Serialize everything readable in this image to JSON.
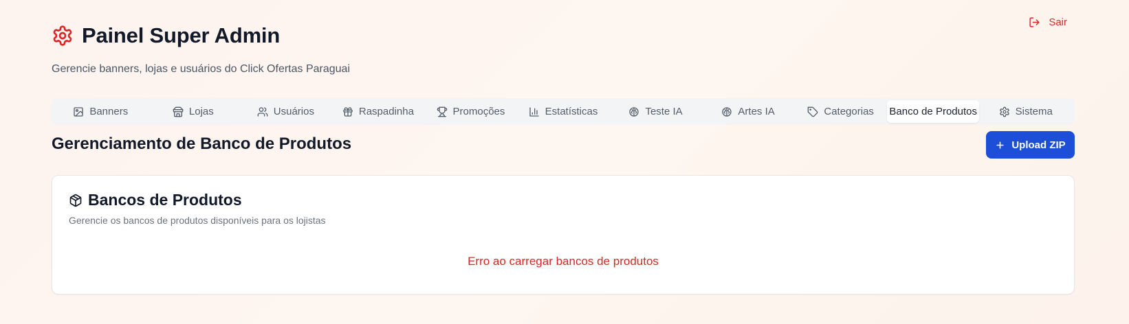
{
  "header": {
    "title": "Painel Super Admin",
    "subtitle": "Gerencie banners, lojas e usuários do Click Ofertas Paraguai",
    "logout_label": "Sair",
    "icon": "gear-icon"
  },
  "colors": {
    "accent_red": "#dc2626",
    "primary_blue": "#1d4ed8",
    "tab_bg": "#f3f4f6"
  },
  "tabs": [
    {
      "label": "Banners",
      "icon": "image-icon"
    },
    {
      "label": "Lojas",
      "icon": "store-icon"
    },
    {
      "label": "Usuários",
      "icon": "users-icon"
    },
    {
      "label": "Raspadinha",
      "icon": "gift-icon"
    },
    {
      "label": "Promoções",
      "icon": "trophy-icon"
    },
    {
      "label": "Estatísticas",
      "icon": "bar-chart-icon"
    },
    {
      "label": "Teste IA",
      "icon": "brain-icon"
    },
    {
      "label": "Artes IA",
      "icon": "brain-icon"
    },
    {
      "label": "Categorias",
      "icon": "tag-icon"
    },
    {
      "label": "Banco de Produtos",
      "icon": "",
      "active": true
    },
    {
      "label": "Sistema",
      "icon": "gear-icon"
    }
  ],
  "section": {
    "title": "Gerenciamento de Banco de Produtos",
    "upload_label": "Upload ZIP"
  },
  "card": {
    "title": "Bancos de Produtos",
    "description": "Gerencie os bancos de produtos disponíveis para os lojistas",
    "error": "Erro ao carregar bancos de produtos",
    "icon": "package-icon"
  }
}
